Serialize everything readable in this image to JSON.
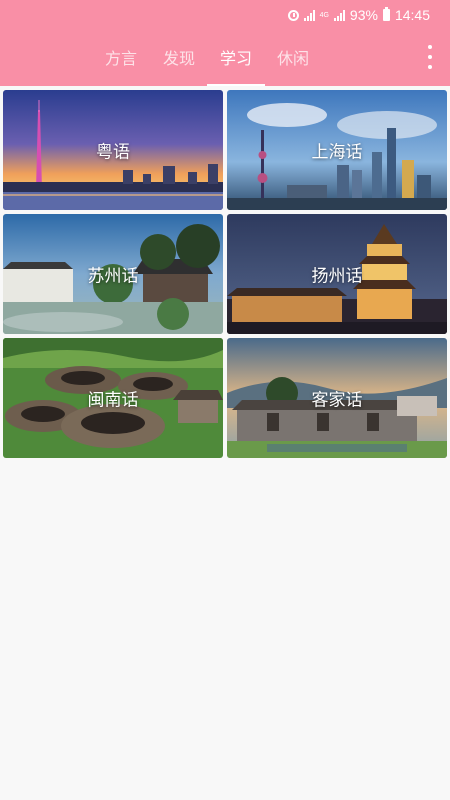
{
  "status": {
    "battery": "93%",
    "time": "14:45",
    "net1": "4G",
    "net2": "4G"
  },
  "tabs": [
    {
      "label": "方言"
    },
    {
      "label": "发现"
    },
    {
      "label": "学习",
      "active": true
    },
    {
      "label": "休闲"
    }
  ],
  "cards": [
    {
      "label": "粤语"
    },
    {
      "label": "上海话"
    },
    {
      "label": "苏州话"
    },
    {
      "label": "扬州话"
    },
    {
      "label": "闽南话"
    },
    {
      "label": "客家话"
    }
  ],
  "colors": {
    "app_bar": "#f98fa6",
    "background": "#f8f8f8"
  }
}
